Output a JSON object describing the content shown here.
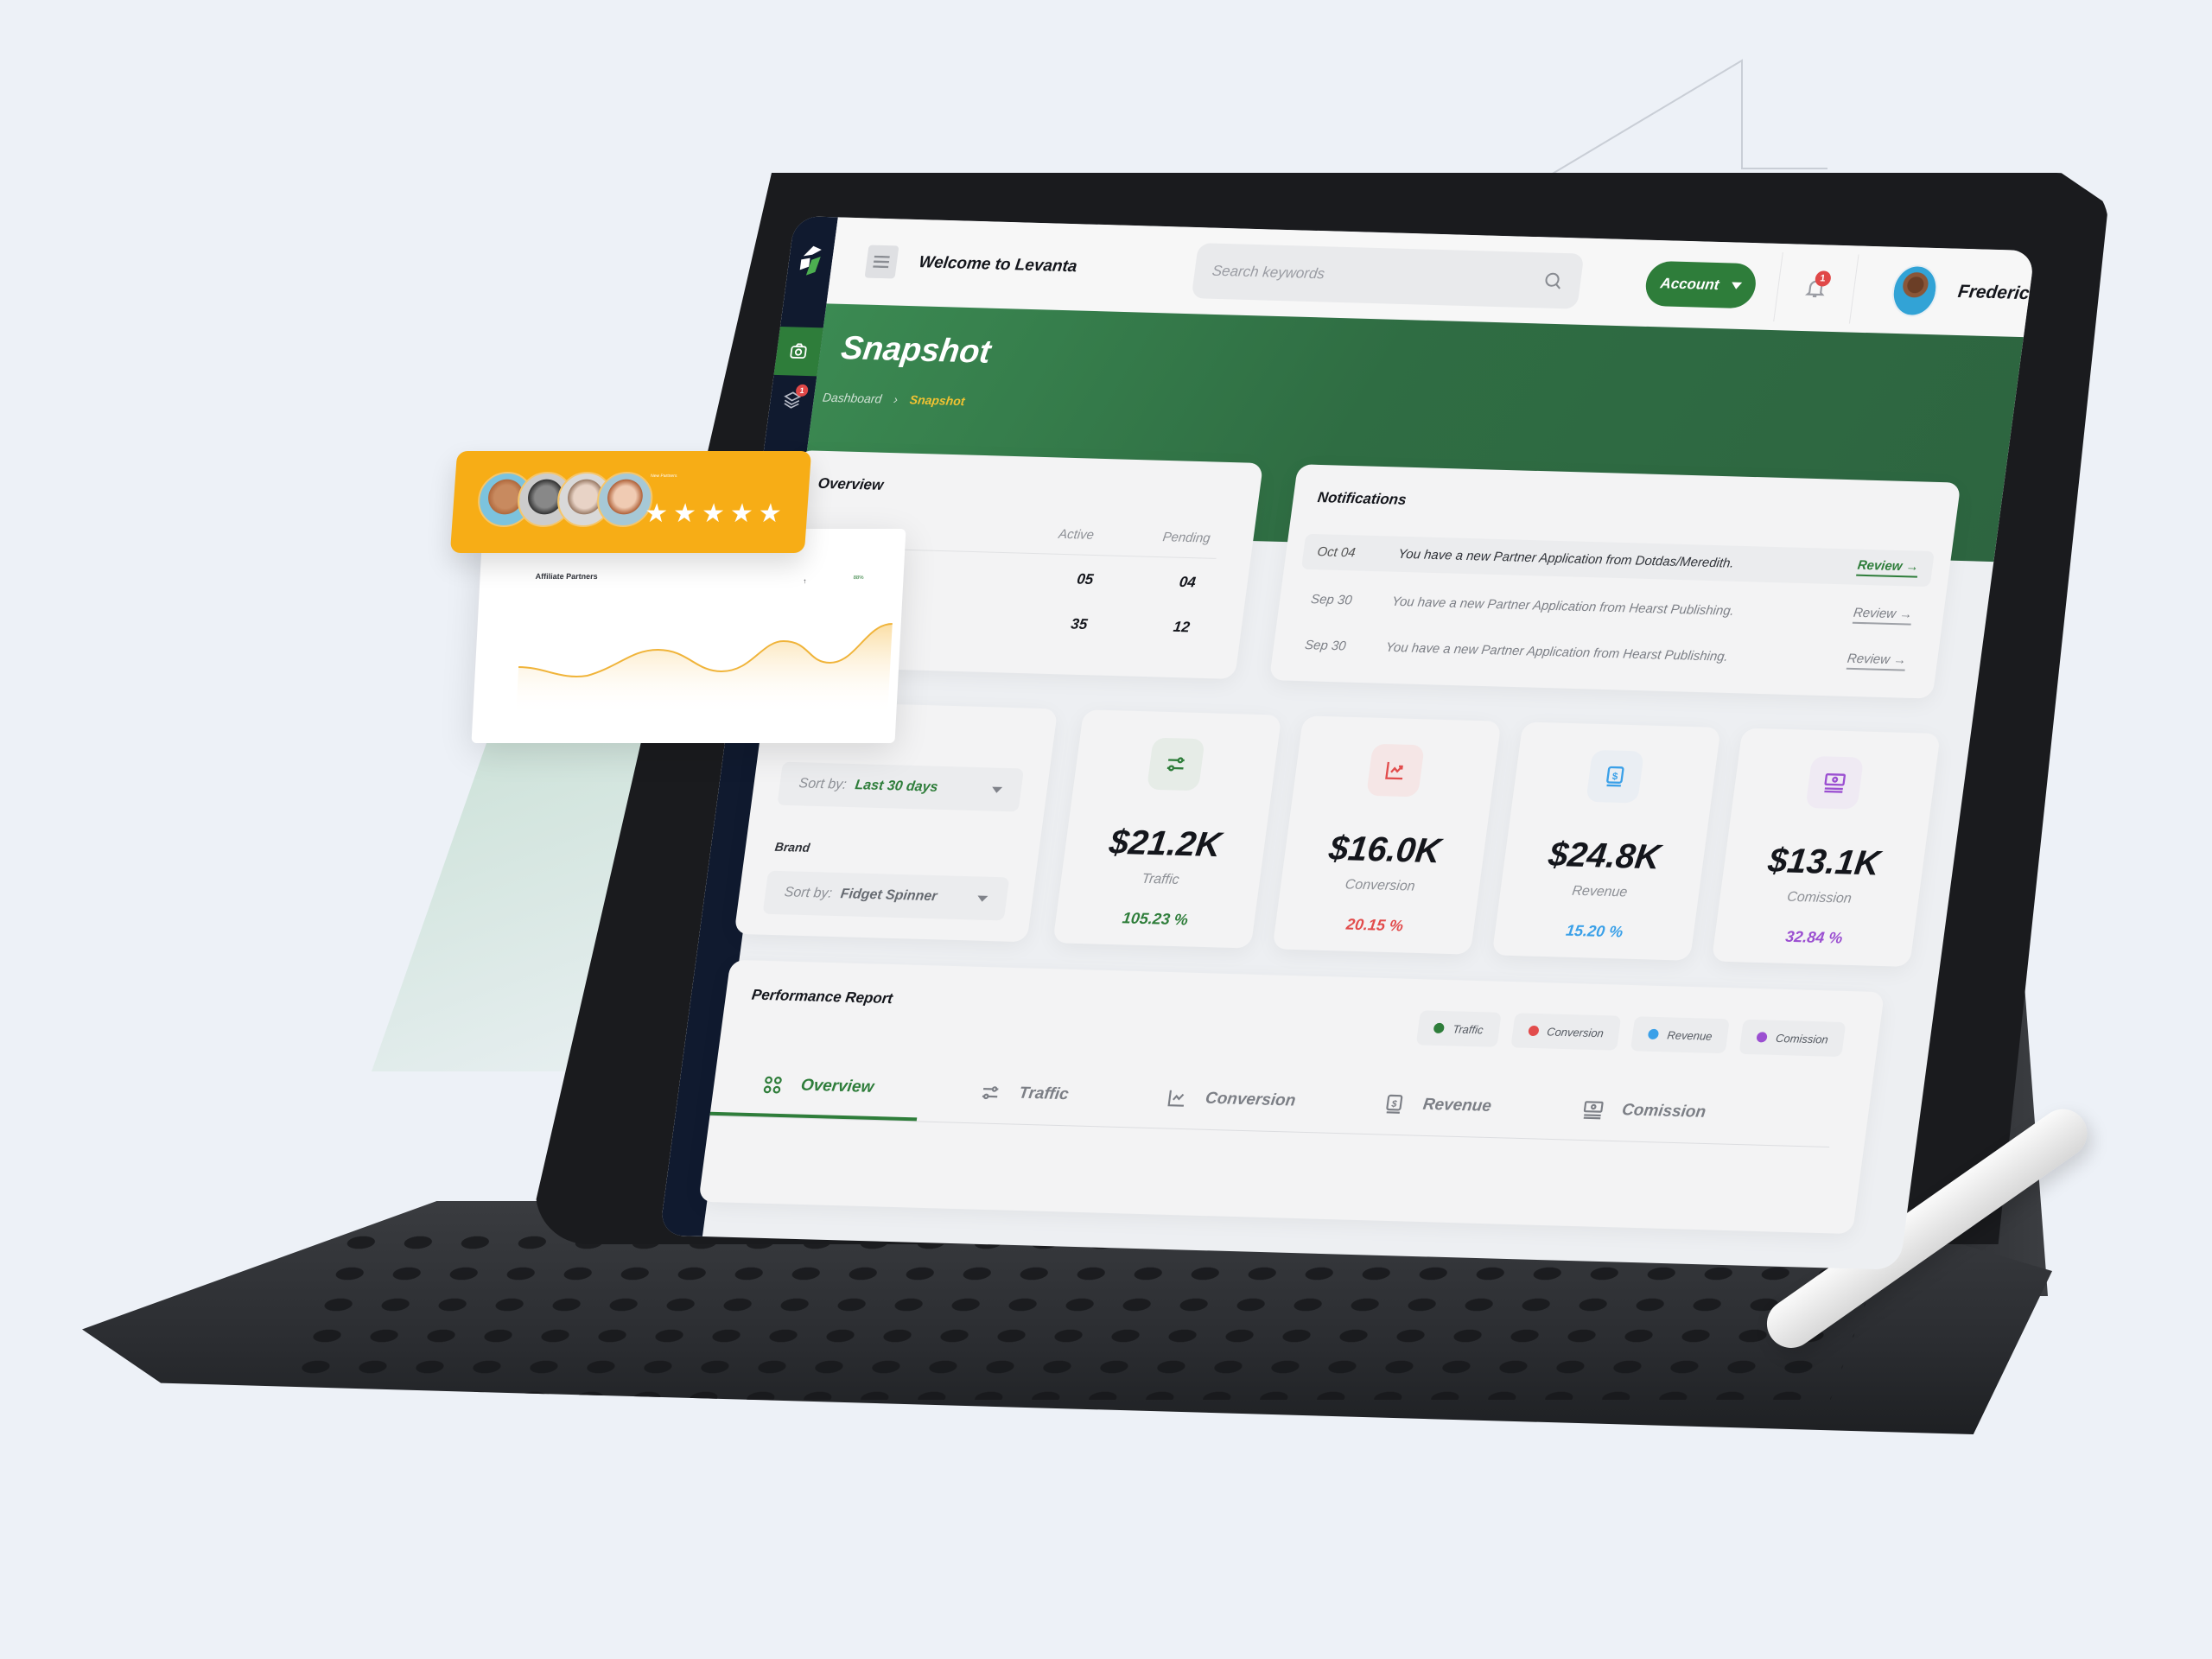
{
  "app": {
    "name": "Levanta",
    "welcome": "Welcome to Levanta"
  },
  "topbar": {
    "search_placeholder": "Search keywords",
    "account_label": "Account",
    "notification_count": "1",
    "user_name": "Frederic"
  },
  "sidebar": {
    "items": [
      {
        "icon": "camera-icon",
        "active": true
      },
      {
        "icon": "layers-icon",
        "badge": "1"
      }
    ]
  },
  "page": {
    "title": "Snapshot",
    "breadcrumb": [
      "Dashboard",
      "Snapshot"
    ]
  },
  "overview": {
    "title": "Overview",
    "columns": [
      "Active",
      "Pending"
    ],
    "rows": [
      {
        "active": "05",
        "pending": "04"
      },
      {
        "active": "35",
        "pending": "12"
      }
    ]
  },
  "notifications": {
    "title": "Notifications",
    "items": [
      {
        "date": "Oct 04",
        "message": "You have a new Partner Application from Dotdas/Meredith.",
        "action": "Review"
      },
      {
        "date": "Sep 30",
        "message": "You have a new Partner Application from Hearst Publishing.",
        "action": "Review"
      },
      {
        "date": "Sep 30",
        "message": "You have a new Partner Application from Hearst Publishing.",
        "action": "Review"
      }
    ]
  },
  "filters": {
    "date_sort_label": "Sort by:",
    "date_sort_value": "Last 30 days",
    "brand_label": "Brand",
    "brand_sort_label": "Sort by:",
    "brand_sort_value": "Fidget Spinner"
  },
  "stats": [
    {
      "label": "Traffic",
      "value": "$21.2K",
      "change": "105.23 %",
      "color": "#2e7d3a",
      "icon": "sliders-icon"
    },
    {
      "label": "Conversion",
      "value": "$16.0K",
      "change": "20.15 %",
      "color": "#e24c4c",
      "icon": "trend-chart-icon"
    },
    {
      "label": "Revenue",
      "value": "$24.8K",
      "change": "15.20 %",
      "color": "#3aa0e8",
      "icon": "dollar-book-icon"
    },
    {
      "label": "Comission",
      "value": "$13.1K",
      "change": "32.84 %",
      "color": "#9b4fd1",
      "icon": "cash-icon"
    }
  ],
  "performance": {
    "title": "Performance Report",
    "legend": [
      {
        "label": "Traffic",
        "color": "#2e7d3a"
      },
      {
        "label": "Conversion",
        "color": "#e24c4c"
      },
      {
        "label": "Revenue",
        "color": "#3aa0e8"
      },
      {
        "label": "Comission",
        "color": "#9b4fd1"
      }
    ],
    "tabs": [
      {
        "label": "Overview",
        "icon": "grid-circles-icon",
        "active": true
      },
      {
        "label": "Traffic",
        "icon": "sliders-icon"
      },
      {
        "label": "Conversion",
        "icon": "trend-chart-icon"
      },
      {
        "label": "Revenue",
        "icon": "dollar-book-icon"
      },
      {
        "label": "Comission",
        "icon": "cash-icon"
      }
    ]
  },
  "floating": {
    "rating": {
      "label": "New Partners",
      "stars": 5,
      "max_stars": 5
    },
    "affiliate_chart": {
      "title": "Affiliate Partners",
      "trend": "↑",
      "percent": "88%"
    }
  }
}
